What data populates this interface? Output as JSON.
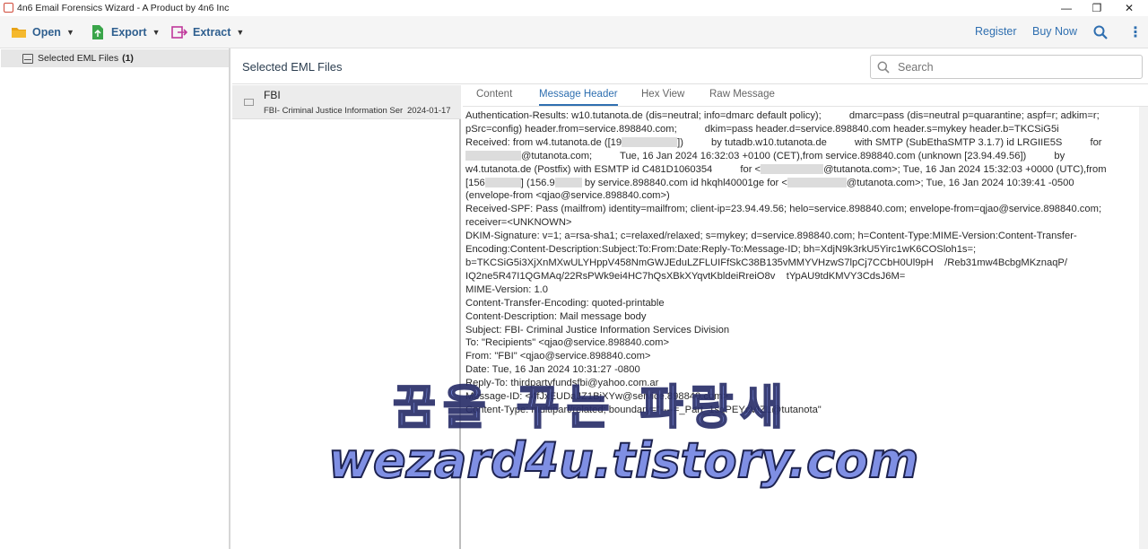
{
  "window": {
    "title": "4n6 Email Forensics Wizard - A Product by 4n6 Inc",
    "min": "—",
    "restore": "❐",
    "close": "✕"
  },
  "toolbar": {
    "open_label": "Open",
    "export_label": "Export",
    "extract_label": "Extract",
    "register_label": "Register",
    "buy_label": "Buy Now",
    "more": "⋮"
  },
  "sidebar": {
    "item_label": "Selected EML Files",
    "item_count": "(1)"
  },
  "main": {
    "title": "Selected EML Files",
    "search_placeholder": "Search"
  },
  "email_list": [
    {
      "from": "FBI",
      "subject": "FBI- Criminal Justice Information Services Division",
      "date": "2024-01-17"
    }
  ],
  "tabs": [
    "Content",
    "Message Header",
    "Hex View",
    "Raw Message"
  ],
  "header_lines": {
    "l1": "Authentication-Results: w10.tutanota.de (dis=neutral; info=dmarc default policy);          dmarc=pass (dis=neutral p=quarantine; aspf=r; adkim=r;",
    "l2": "pSrc=config) header.from=service.898840.com;          dkim=pass header.d=service.898840.com header.s=mykey header.b=TKCSiG5i",
    "l3a": "Received: from w4.tutanota.de ([19",
    "l3b": "])          by tutadb.w10.tutanota.de          with SMTP (SubEthaSMTP 3.1.7) id LRGIIE5S          for",
    "l4": "@tutanota.com;          Tue, 16 Jan 2024 16:32:03 +0100 (CET),from service.898840.com (unknown [23.94.49.56])          by",
    "l5a": "w4.tutanota.de (Postfix) with ESMTP id C481D1060354          for <",
    "l5b": "@tutanota.com>; Tue, 16 Jan 2024 15:32:03 +0000 (UTC),from",
    "l6a": "[156",
    "l6b": "] (156.9",
    "l6c": "by service.898840.com id hkqhl40001ge for <",
    "l6d": "@tutanota.com>; Tue, 16 Jan 2024 10:39:41 -0500",
    "l7": "(envelope-from <qjao@service.898840.com>)",
    "l8": "Received-SPF: Pass (mailfrom) identity=mailfrom; client-ip=23.94.49.56; helo=service.898840.com; envelope-from=qjao@service.898840.com;",
    "l9": "receiver=<UNKNOWN>",
    "l10": "DKIM-Signature: v=1; a=rsa-sha1; c=relaxed/relaxed; s=mykey; d=service.898840.com; h=Content-Type:MIME-Version:Content-Transfer-",
    "l11": "Encoding:Content-Description:Subject:To:From:Date:Reply-To:Message-ID; bh=XdjN9k3rkU5Yirc1wK6COSloh1s=;",
    "l12": "b=TKCSiG5i3XjXnMXwULYHppV458NmGWJEduLZFLUIFfSkC38B135vMMYVHzwS7lpCj7CCbH0Ul9pH    /Reb31mw4BcbgMKznaqP/",
    "l13": "IQ2ne5R47I1QGMAq/22RsPWk9ei4HC7hQsXBkXYqvtKbldeiRreiO8v    tYpAU9tdKMVY3CdsJ6M=",
    "l14": "MIME-Version: 1.0",
    "l15": "Content-Transfer-Encoding: quoted-printable",
    "l16": "Content-Description: Mail message body",
    "l17": "Subject: FBI- Criminal Justice Information Services Division",
    "l18": "To: \"Recipients\" <qjao@service.898840.com>",
    "l19": "From: \"FBI\" <qjao@service.898840.com>",
    "l20": "Date: Tue, 16 Jan 2024 10:31:27 -0800",
    "l21": "Reply-To: thirdpartyfundsfbi@yahoo.com.ar",
    "l22": "Message-ID: <4fJxEUDaJZ1BjXYw@service.898840.com>",
    "l23": "Content-Type: multipart/related; boundary=\"----=_Part_1sqPEYcVIZL@tutanota\""
  },
  "watermark": {
    "korean": "꿈을 꾸는 파랑새",
    "url": "wezard4u.tistory.com"
  },
  "colors": {
    "accent": "#2f6fb0",
    "open_icon": "#e8a317",
    "export_icon": "#3aa54a",
    "extract_icon": "#c0399b"
  }
}
